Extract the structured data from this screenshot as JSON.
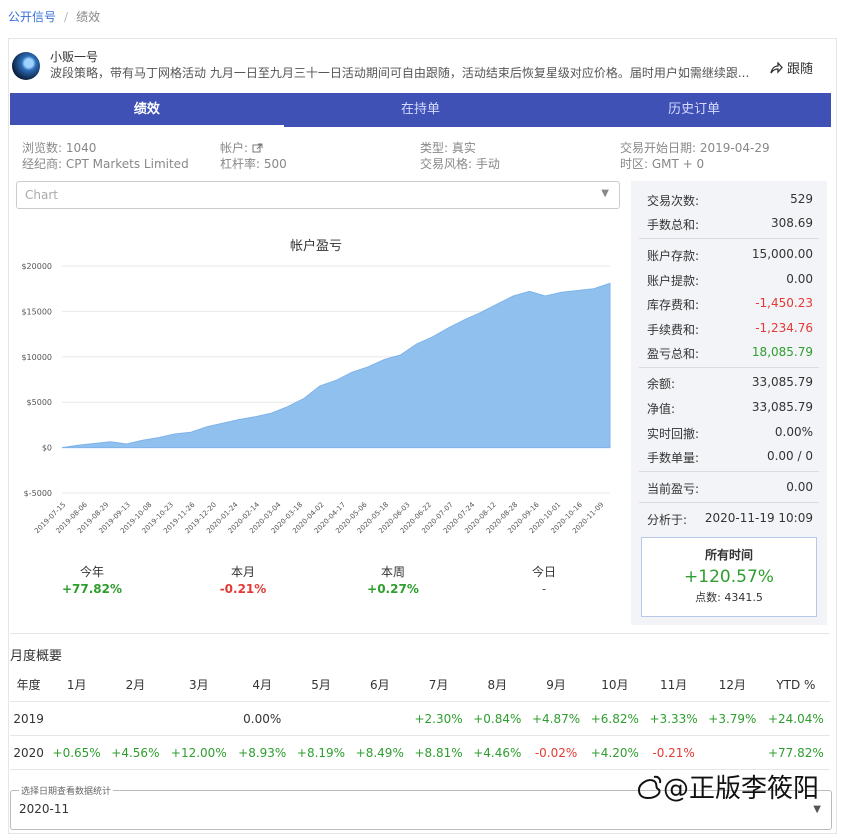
{
  "breadcrumb": {
    "root": "公开信号",
    "sep": "/",
    "current": "绩效"
  },
  "signal": {
    "name": "小贩一号",
    "description": "波段策略，带有马丁网格活动 九月一日至九月三十一日活动期间可自由跟随，活动结束后恢复星级对应价格。届时用户如需继续跟...",
    "follow_label": "跟随"
  },
  "tabs": [
    {
      "label": "绩效"
    },
    {
      "label": "在持单"
    },
    {
      "label": "历史订单"
    }
  ],
  "info": {
    "views": "浏览数: 1040",
    "broker": "经纪商: CPT Markets Limited",
    "account": "帐户:",
    "leverage": "杠杆率: 500",
    "type": "类型: 真实",
    "style": "交易风格: 手动",
    "start_date": "交易开始日期: 2019-04-29",
    "timezone": "时区: GMT + 0"
  },
  "chart_select": {
    "placeholder": "Chart"
  },
  "chart_data": {
    "type": "area",
    "title": "帐户盈亏",
    "y_ticks": [
      "$20000",
      "$15000",
      "$10000",
      "$5000",
      "$0",
      "$-5000"
    ],
    "ylim": [
      -5000,
      20000
    ],
    "x_tick_labels": [
      "2019-07-15",
      "2019-08-06",
      "2019-08-29",
      "2019-09-13",
      "2019-10-08",
      "2019-10-23",
      "2019-11-26",
      "2019-12-20",
      "2020-01-24",
      "2020-02-14",
      "2020-03-04",
      "2020-03-18",
      "2020-04-02",
      "2020-04-17",
      "2020-05-06",
      "2020-05-18",
      "2020-06-03",
      "2020-06-22",
      "2020-07-07",
      "2020-07-24",
      "2020-08-12",
      "2020-08-28",
      "2020-09-16",
      "2020-10-01",
      "2020-10-16",
      "2020-11-09"
    ],
    "values": [
      0,
      250,
      450,
      650,
      400,
      800,
      1100,
      1500,
      1700,
      2300,
      2700,
      3100,
      3400,
      3800,
      4500,
      5400,
      6800,
      7400,
      8300,
      8900,
      9700,
      10200,
      11400,
      12200,
      13200,
      14100,
      14900,
      15800,
      16700,
      17200,
      16700,
      17100,
      17300,
      17500,
      18100
    ],
    "color": "#90c0ee"
  },
  "performance": [
    {
      "label": "今年",
      "value": "+77.82%",
      "tone": "green"
    },
    {
      "label": "本月",
      "value": "-0.21%",
      "tone": "red"
    },
    {
      "label": "本周",
      "value": "+0.27%",
      "tone": "green"
    },
    {
      "label": "今日",
      "value": "-",
      "tone": "neutral"
    }
  ],
  "stats": [
    {
      "label": "交易次数:",
      "value": "529",
      "tone": "neutral"
    },
    {
      "label": "手数总和:",
      "value": "308.69",
      "tone": "neutral"
    },
    {
      "label": "账户存款:",
      "value": "15,000.00",
      "tone": "neutral"
    },
    {
      "label": "账户提款:",
      "value": "0.00",
      "tone": "neutral"
    },
    {
      "label": "库存费和:",
      "value": "-1,450.23",
      "tone": "red"
    },
    {
      "label": "手续费和:",
      "value": "-1,234.76",
      "tone": "red"
    },
    {
      "label": "盈亏总和:",
      "value": "18,085.79",
      "tone": "green"
    },
    {
      "label": "余额:",
      "value": "33,085.79",
      "tone": "neutral"
    },
    {
      "label": "净值:",
      "value": "33,085.79",
      "tone": "neutral"
    },
    {
      "label": "实时回撤:",
      "value": "0.00%",
      "tone": "neutral"
    },
    {
      "label": "手数单量:",
      "value": "0.00 / 0",
      "tone": "neutral"
    },
    {
      "label": "当前盈亏:",
      "value": "0.00",
      "tone": "neutral"
    },
    {
      "label": "分析于:",
      "value": "2020-11-19 10:09",
      "tone": "neutral"
    }
  ],
  "all_time": {
    "title": "所有时间",
    "value": "+120.57%",
    "points": "点数: 4341.5"
  },
  "monthly": {
    "title": "月度概要",
    "headers": [
      "年度",
      "1月",
      "2月",
      "3月",
      "4月",
      "5月",
      "6月",
      "7月",
      "8月",
      "9月",
      "10月",
      "11月",
      "12月",
      "YTD %"
    ],
    "rows": [
      [
        "2019",
        "",
        "",
        "",
        "0.00%",
        "",
        "",
        "+2.30%",
        "+0.84%",
        "+4.87%",
        "+6.82%",
        "+3.33%",
        "+3.79%",
        "+24.04%"
      ],
      [
        "2020",
        "+0.65%",
        "+4.56%",
        "+12.00%",
        "+8.93%",
        "+8.19%",
        "+8.49%",
        "+8.81%",
        "+4.46%",
        "-0.02%",
        "+4.20%",
        "-0.21%",
        "",
        "+77.82%"
      ]
    ]
  },
  "date_select": {
    "legend": "选择日期查看数据统计",
    "value": "2020-11"
  },
  "watermark": "@正版李筱阳",
  "colors": {
    "primary": "#3f51b5",
    "green": "#2e9e2e",
    "red": "#e53935"
  }
}
